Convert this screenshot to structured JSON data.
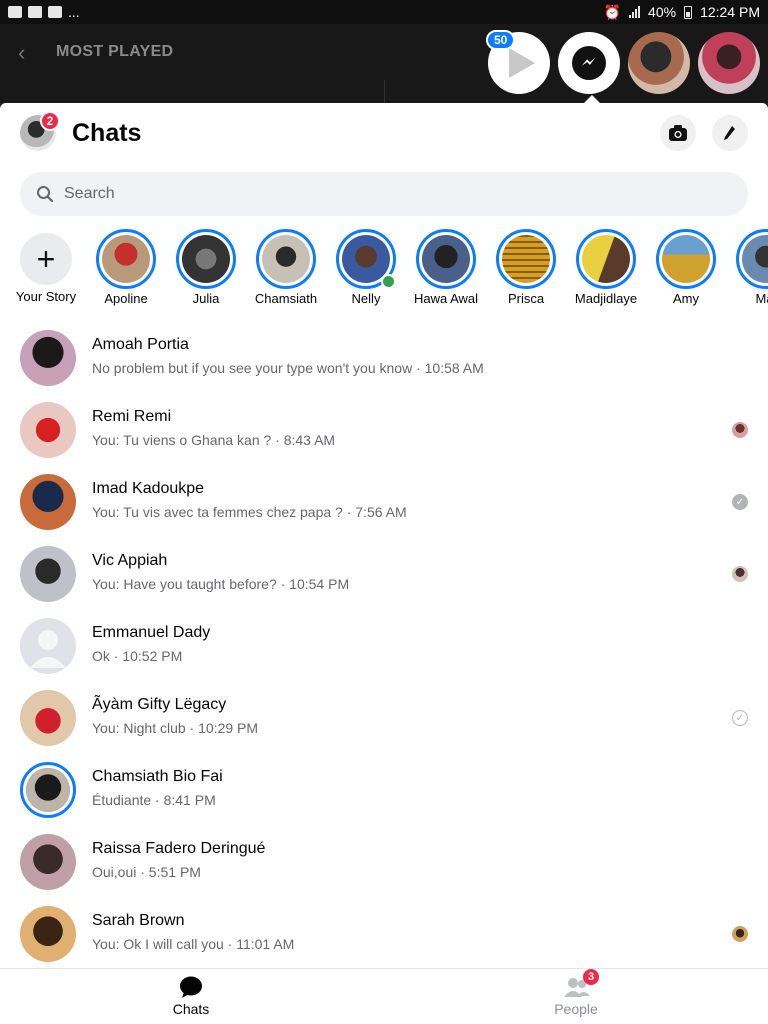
{
  "status_bar": {
    "battery": "40%",
    "time": "12:24 PM",
    "more": "..."
  },
  "background_app": {
    "title": "MOST PLAYED"
  },
  "chat_heads": {
    "badge": "50"
  },
  "header": {
    "title": "Chats",
    "profile_badge": "2"
  },
  "search": {
    "placeholder": "Search"
  },
  "stories": [
    {
      "name": "Your Story"
    },
    {
      "name": "Apoline"
    },
    {
      "name": "Julia"
    },
    {
      "name": "Chamsiath"
    },
    {
      "name": "Nelly"
    },
    {
      "name": "Hawa Awal"
    },
    {
      "name": "Prisca"
    },
    {
      "name": "Madjidlaye"
    },
    {
      "name": "Amy"
    },
    {
      "name": "Mal"
    }
  ],
  "chats": [
    {
      "name": "Amoah Portia",
      "preview": "No problem but if you see your type won't you know · 10:58 AM"
    },
    {
      "name": "Remi Remi",
      "preview": "You: Tu viens o Ghana kan ? · 8:43 AM",
      "status": "seen-avatar"
    },
    {
      "name": "Imad Kadoukpe",
      "preview": "You: Tu vis avec ta femmes chez papa ? · 7:56 AM",
      "status": "delivered"
    },
    {
      "name": "Vic Appiah",
      "preview": "You: Have you taught before? · 10:54 PM",
      "status": "seen-avatar"
    },
    {
      "name": "Emmanuel Dady",
      "preview": "Ok · 10:52 PM"
    },
    {
      "name": "Ãyàm Gifty Lëgacy",
      "preview": "You: Night club · 10:29 PM",
      "status": "sent"
    },
    {
      "name": "Chamsiath Bio Fai",
      "preview": "Étudiante · 8:41 PM"
    },
    {
      "name": "Raissa Fadero Deringué",
      "preview": "Oui,oui · 5:51 PM"
    },
    {
      "name": "Sarah Brown",
      "preview": "You: Ok I will call you · 11:01 AM",
      "status": "seen-avatar"
    }
  ],
  "bottom_nav": {
    "chats_label": "Chats",
    "people_label": "People",
    "people_badge": "3"
  },
  "colors": {
    "accent": "#0a7cff",
    "badge": "#f02849",
    "online": "#31a24c"
  }
}
